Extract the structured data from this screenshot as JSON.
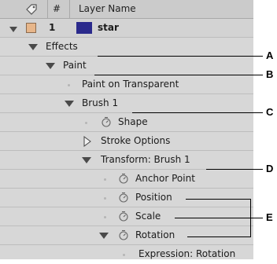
{
  "header": {
    "label_icon": "tag-icon",
    "number_col": "#",
    "name_col": "Layer Name"
  },
  "layer": {
    "number": "1",
    "name": "star",
    "label_color": "#e7b68a",
    "layer_color": "#2b2a8c"
  },
  "properties": {
    "effects": "Effects",
    "paint": "Paint",
    "paint_on_transparent": "Paint on Transparent",
    "brush1": "Brush 1",
    "shape": "Shape",
    "stroke_options": "Stroke Options",
    "transform": "Transform: Brush 1",
    "anchor_point": "Anchor Point",
    "position": "Position",
    "scale": "Scale",
    "rotation": "Rotation",
    "expression_rotation": "Expression: Rotation"
  },
  "callouts": {
    "a": "A",
    "b": "B",
    "c": "C",
    "d": "D",
    "e": "E"
  }
}
